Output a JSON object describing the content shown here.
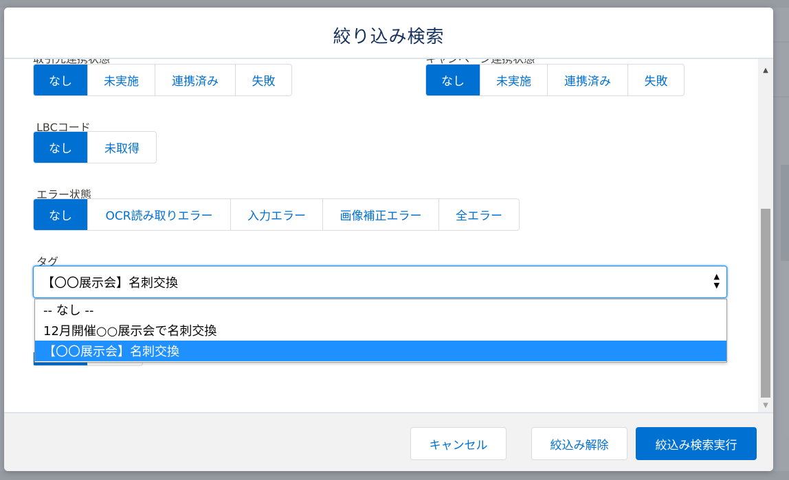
{
  "modal": {
    "title": "絞り込み検索"
  },
  "filters": {
    "partner_sync": {
      "label": "取引先連携状態",
      "options": [
        "なし",
        "未実施",
        "連携済み",
        "失敗"
      ],
      "selected": "なし"
    },
    "campaign_sync": {
      "label": "キャンペーン連携状態",
      "options": [
        "なし",
        "未実施",
        "連携済み",
        "失敗"
      ],
      "selected": "なし"
    },
    "lbc_code": {
      "label": "LBCコード",
      "options": [
        "なし",
        "未取得"
      ],
      "selected": "なし"
    },
    "error_status": {
      "label": "エラー状態",
      "options": [
        "なし",
        "OCR読み取りエラー",
        "入力エラー",
        "画像補正エラー",
        "全エラー"
      ],
      "selected": "なし"
    },
    "tag": {
      "label": "タグ",
      "value": "【〇〇展示会】名刺交換",
      "options": [
        "-- なし --",
        "12月開催○○展示会で名刺交換",
        "【〇〇展示会】名刺交換"
      ],
      "highlighted_index": 2
    }
  },
  "footer": {
    "cancel_label": "キャンセル",
    "clear_label": "絞込み解除",
    "submit_label": "絞込み検索実行"
  },
  "colors": {
    "brand": "#0070d2",
    "highlight": "#1e90ff",
    "title": "#16325c"
  }
}
